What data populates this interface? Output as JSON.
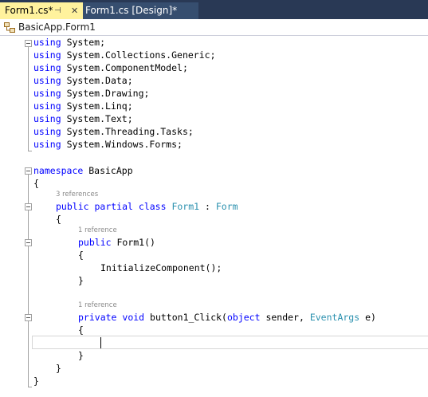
{
  "tabs": [
    {
      "label": "Form1.cs*",
      "pin_glyph": "⊣",
      "close_glyph": "✕"
    },
    {
      "label": "Form1.cs [Design]*"
    }
  ],
  "navigation": {
    "scope": "BasicApp.Form1",
    "icon": "class-icon"
  },
  "code": {
    "usings": [
      {
        "keyword": "using",
        "namespace": "System;"
      },
      {
        "keyword": "using",
        "namespace": "System.Collections.Generic;"
      },
      {
        "keyword": "using",
        "namespace": "System.ComponentModel;"
      },
      {
        "keyword": "using",
        "namespace": "System.Data;"
      },
      {
        "keyword": "using",
        "namespace": "System.Drawing;"
      },
      {
        "keyword": "using",
        "namespace": "System.Linq;"
      },
      {
        "keyword": "using",
        "namespace": "System.Text;"
      },
      {
        "keyword": "using",
        "namespace": "System.Threading.Tasks;"
      },
      {
        "keyword": "using",
        "namespace": "System.Windows.Forms;"
      }
    ],
    "namespace_keyword": "namespace",
    "namespace_name": " BasicApp",
    "open_brace": "{",
    "close_brace": "}",
    "class_refs": "3 references",
    "class_kw1": "public",
    "class_kw2": "partial",
    "class_kw3": "class",
    "class_name": "Form1",
    "class_colon": " : ",
    "class_base": "Form",
    "ctor_refs": "1 reference",
    "ctor_kw": "public",
    "ctor_name": " Form1()",
    "init_call": "InitializeComponent();",
    "click_refs": "1 reference",
    "click_kw1": "private",
    "click_kw2": "void",
    "click_name": " button1_Click(",
    "click_kw3": "object",
    "click_sender": " sender, ",
    "click_type": "EventArgs",
    "click_end": " e)"
  },
  "colors": {
    "keyword": "#0000ff",
    "type": "#2b91af",
    "tab_active_bg": "#fff29d",
    "tab_inactive_bg": "#364e6f",
    "tabbar_bg": "#293955"
  }
}
